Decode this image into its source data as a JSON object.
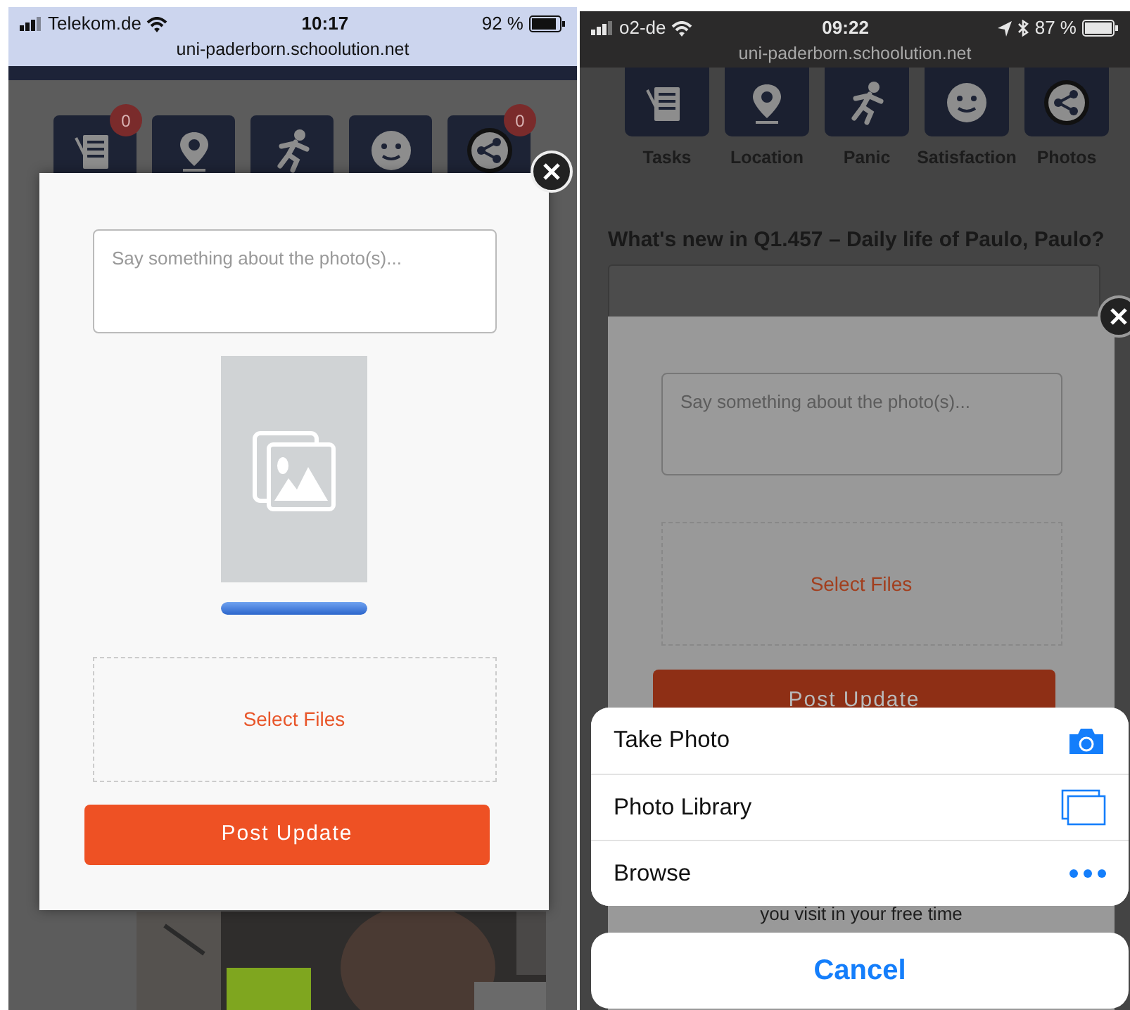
{
  "screens": [
    {
      "status_bar": {
        "carrier": "Telekom.de",
        "time": "10:17",
        "battery": "92 %",
        "url": "uni-paderborn.schoolution.net"
      },
      "tiles": [
        {
          "kind": "tasks",
          "badge": "0"
        },
        {
          "kind": "location"
        },
        {
          "kind": "panic"
        },
        {
          "kind": "satisfaction"
        },
        {
          "kind": "photos",
          "badge": "0"
        }
      ],
      "modal": {
        "caption_placeholder": "Say something about the photo(s)...",
        "attachments": [
          {
            "kind": "image-placeholder",
            "level": 1
          }
        ],
        "dropzone": "Select Files",
        "submit": "Post Update"
      }
    },
    {
      "status_bar": {
        "carrier": "o2-de",
        "time": "09:22",
        "location": true,
        "bluetooth": true,
        "battery": "87 %",
        "url": "uni-paderborn.schoolution.net"
      },
      "tiles": [
        {
          "kind": "tasks",
          "label": "Tasks"
        },
        {
          "kind": "location",
          "label": "Location"
        },
        {
          "kind": "panic",
          "label": "Panic"
        },
        {
          "kind": "satisfaction",
          "label": "Satisfaction"
        },
        {
          "kind": "photos",
          "label": "Photos"
        }
      ],
      "heading": "What's new in Q1.457 – Daily life of Paulo, Paulo?",
      "post_field": {
        "kind": "textarea"
      },
      "modal": {
        "dimmed": true,
        "caption_placeholder": "Say something about the photo(s)...",
        "dropzone": "Select Files",
        "submit": "Post Update",
        "text_below": "you visit in your free time"
      },
      "action_sheet": {
        "options": [
          {
            "kind": "camera",
            "label": "Take Photo"
          },
          {
            "kind": "library",
            "label": "Photo Library"
          },
          {
            "kind": "browse",
            "label": "Browse"
          }
        ],
        "cancel": "Cancel"
      }
    }
  ]
}
